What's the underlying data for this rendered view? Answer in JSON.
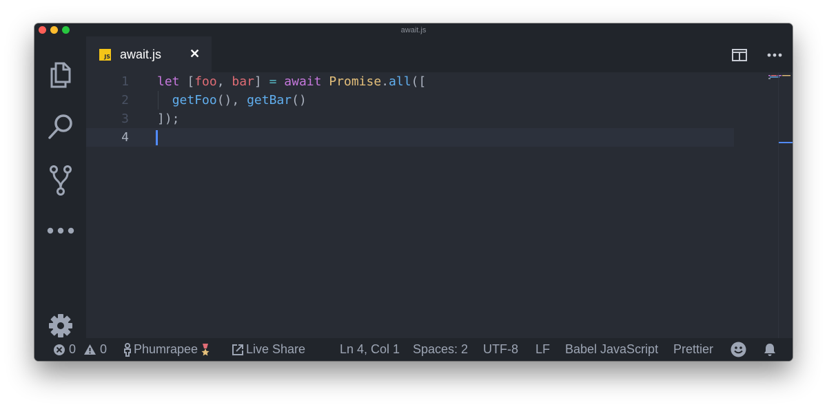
{
  "window": {
    "title": "await.js"
  },
  "tabs": [
    {
      "label": "await.js",
      "file_icon_text": "JS",
      "close_glyph": "✕"
    }
  ],
  "activity_bar": {
    "items": [
      {
        "icon": "files-icon"
      },
      {
        "icon": "search-icon"
      },
      {
        "icon": "source-control-icon"
      },
      {
        "icon": "more-icon"
      }
    ],
    "bottom": {
      "icon": "gear-icon"
    }
  },
  "editor": {
    "lines": [
      {
        "number": "1",
        "code": "let [foo, bar] = await Promise.all(["
      },
      {
        "number": "2",
        "code": "  getFoo(), getBar()"
      },
      {
        "number": "3",
        "code": "]);"
      },
      {
        "number": "4",
        "code": ""
      }
    ],
    "current_line": 4
  },
  "status_bar": {
    "errors": "0",
    "warnings": "0",
    "user": "Phumrapee",
    "live_share": "Live Share",
    "cursor_position": "Ln 4, Col 1",
    "indentation": "Spaces: 2",
    "encoding": "UTF-8",
    "line_ending": "LF",
    "language": "Babel JavaScript",
    "formatter": "Prettier"
  },
  "colors": {
    "editor_bg": "#282c34",
    "chrome_bg": "#21252b",
    "keyword": "#c678dd",
    "variable": "#e06c75",
    "class": "#e5c07b",
    "function": "#61afef",
    "operator": "#56b6c2",
    "cursor": "#528bff"
  }
}
